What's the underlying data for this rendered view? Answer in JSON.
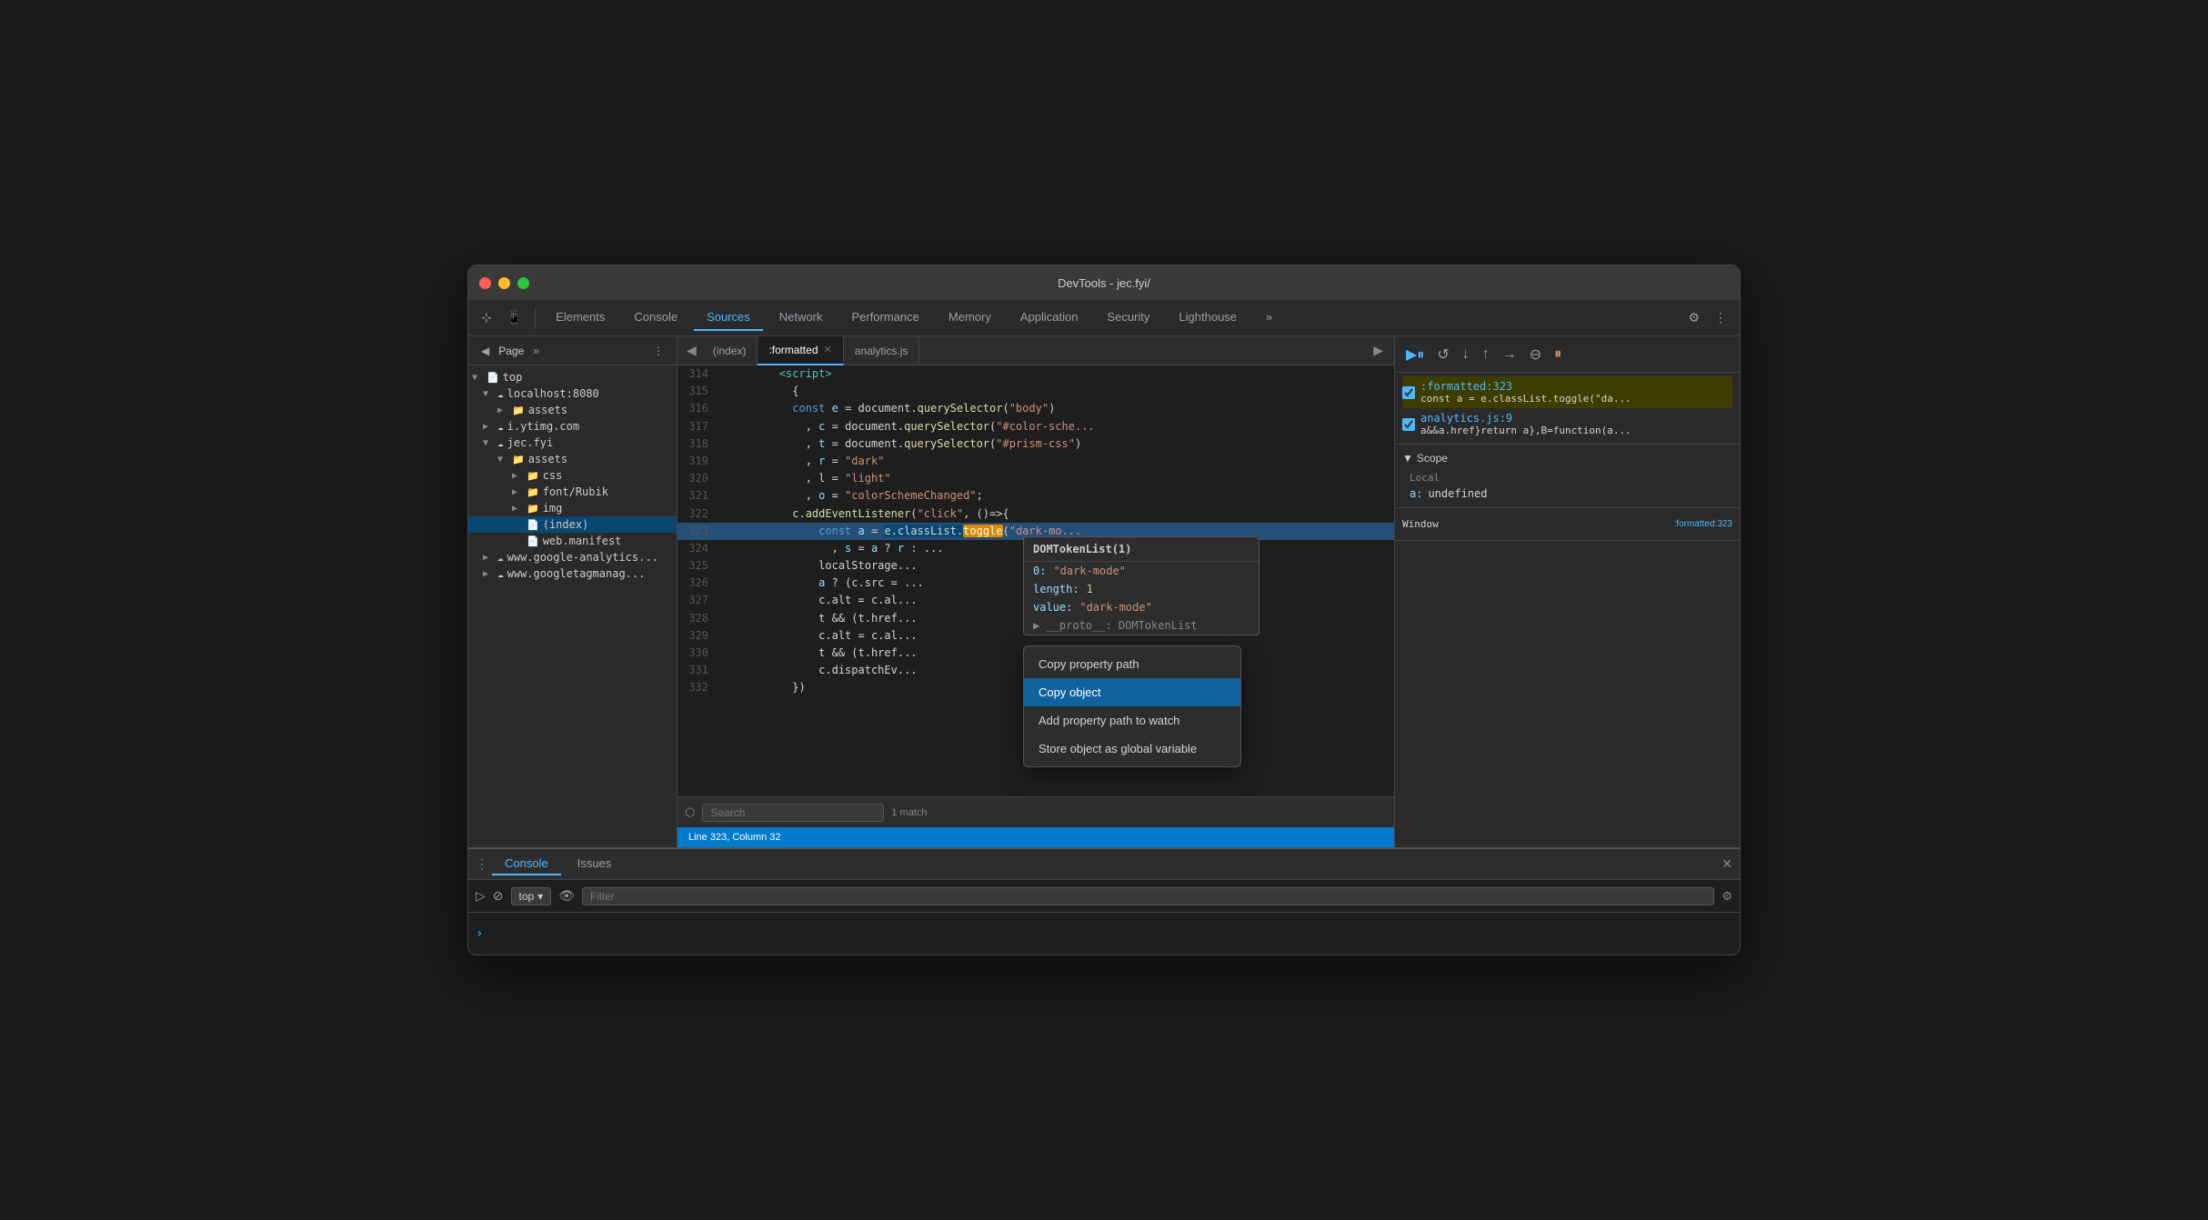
{
  "window": {
    "title": "DevTools - jec.fyi/"
  },
  "toolbar": {
    "tabs": [
      {
        "label": "Elements",
        "active": false
      },
      {
        "label": "Console",
        "active": false
      },
      {
        "label": "Sources",
        "active": true
      },
      {
        "label": "Network",
        "active": false
      },
      {
        "label": "Performance",
        "active": false
      },
      {
        "label": "Memory",
        "active": false
      },
      {
        "label": "Application",
        "active": false
      },
      {
        "label": "Security",
        "active": false
      },
      {
        "label": "Lighthouse",
        "active": false
      }
    ]
  },
  "sidebar": {
    "title": "Page",
    "tree": [
      {
        "label": "top",
        "indent": 0,
        "type": "arrow",
        "expanded": true
      },
      {
        "label": "localhost:8080",
        "indent": 1,
        "type": "cloud",
        "expanded": true
      },
      {
        "label": "assets",
        "indent": 2,
        "type": "folder"
      },
      {
        "label": "i.ytimg.com",
        "indent": 1,
        "type": "cloud"
      },
      {
        "label": "jec.fyi",
        "indent": 1,
        "type": "cloud",
        "expanded": true
      },
      {
        "label": "assets",
        "indent": 2,
        "type": "folder",
        "expanded": true
      },
      {
        "label": "css",
        "indent": 3,
        "type": "folder"
      },
      {
        "label": "font/Rubik",
        "indent": 3,
        "type": "folder"
      },
      {
        "label": "img",
        "indent": 3,
        "type": "folder"
      },
      {
        "label": "(index)",
        "indent": 3,
        "type": "file",
        "selected": true
      },
      {
        "label": "web.manifest",
        "indent": 3,
        "type": "file"
      },
      {
        "label": "www.google-analytics...",
        "indent": 1,
        "type": "cloud"
      },
      {
        "label": "www.googletagmanag...",
        "indent": 1,
        "type": "cloud"
      }
    ]
  },
  "editor": {
    "tabs": [
      {
        "label": "(index)",
        "active": false
      },
      {
        "label": ":formatted",
        "active": true,
        "closable": true
      },
      {
        "label": "analytics.js",
        "active": false
      }
    ],
    "lines": [
      {
        "num": 314,
        "content": "    <script>",
        "highlighted": false
      },
      {
        "num": 315,
        "content": "      {",
        "highlighted": false
      },
      {
        "num": 316,
        "content": "        const e = document.querySelector(\"body\")",
        "highlighted": false
      },
      {
        "num": 317,
        "content": "          , c = document.querySelector(\"#color-sche...",
        "highlighted": false
      },
      {
        "num": 318,
        "content": "          , t = document.querySelector(\"#prism-css\")",
        "highlighted": false
      },
      {
        "num": 319,
        "content": "          , r = \"dark\"",
        "highlighted": false
      },
      {
        "num": 320,
        "content": "          , l = \"light\"",
        "highlighted": false
      },
      {
        "num": 321,
        "content": "          , o = \"colorSchemeChanged\";",
        "highlighted": false
      },
      {
        "num": 322,
        "content": "        c.addEventListener(\"click\", ()=>{",
        "highlighted": false
      },
      {
        "num": 323,
        "content": "            const a = e.classList.toggle(\"dark-mo...",
        "highlighted": true
      },
      {
        "num": 324,
        "content": "              , s = a ? r : ...",
        "highlighted": false
      },
      {
        "num": 325,
        "content": "            localStorage...",
        "highlighted": false
      },
      {
        "num": 326,
        "content": "            a ? (c.src = ...",
        "highlighted": false
      },
      {
        "num": 327,
        "content": "            c.alt = c.al...",
        "highlighted": false
      },
      {
        "num": 328,
        "content": "            t && (t.href...",
        "highlighted": false
      },
      {
        "num": 329,
        "content": "            c.alt = c.al...",
        "highlighted": false
      },
      {
        "num": 330,
        "content": "            t && (t.href...",
        "highlighted": false
      },
      {
        "num": 331,
        "content": "            c.dispatchEv...",
        "highlighted": false
      },
      {
        "num": 332,
        "content": "        })",
        "highlighted": false
      }
    ],
    "search": {
      "query": "",
      "placeholder": "Search",
      "match_count": "1 match"
    },
    "status": {
      "line": "Line 323, Column 32"
    }
  },
  "hover_tooltip": {
    "title": "DOMTokenList(1)",
    "rows": [
      {
        "key": "0:",
        "val": "\"dark-mode\"",
        "type": "string"
      },
      {
        "key": "length:",
        "val": "1",
        "type": "number"
      },
      {
        "key": "value:",
        "val": "\"dark-mode\"",
        "type": "string"
      },
      {
        "key": "▶ __proto__:",
        "val": "DOMTokenList",
        "type": "ref"
      }
    ]
  },
  "context_menu": {
    "items": [
      {
        "label": "Copy property path",
        "selected": false
      },
      {
        "label": "Copy object",
        "selected": true
      },
      {
        "label": "Add property path to watch",
        "selected": false
      },
      {
        "label": "Store object as global variable",
        "selected": false
      }
    ]
  },
  "debugger": {
    "breakpoints": [
      {
        "file": ":formatted:323",
        "code": "const a = e.classList.toggle(\"da..."
      },
      {
        "file": "analytics.js:9",
        "code": "a&&a.href}return a},B=function(a..."
      }
    ],
    "scope": {
      "title": "Scope",
      "local_title": "Local",
      "items": [
        {
          "key": "a:",
          "val": "undefined"
        }
      ]
    },
    "call_stack": {
      "items": [
        {
          "label": "Window",
          "location": ":formatted:323"
        }
      ]
    }
  },
  "console": {
    "tabs": [
      {
        "label": "Console",
        "active": true
      },
      {
        "label": "Issues",
        "active": false
      }
    ],
    "top_value": "top",
    "filter_placeholder": "Filter"
  }
}
